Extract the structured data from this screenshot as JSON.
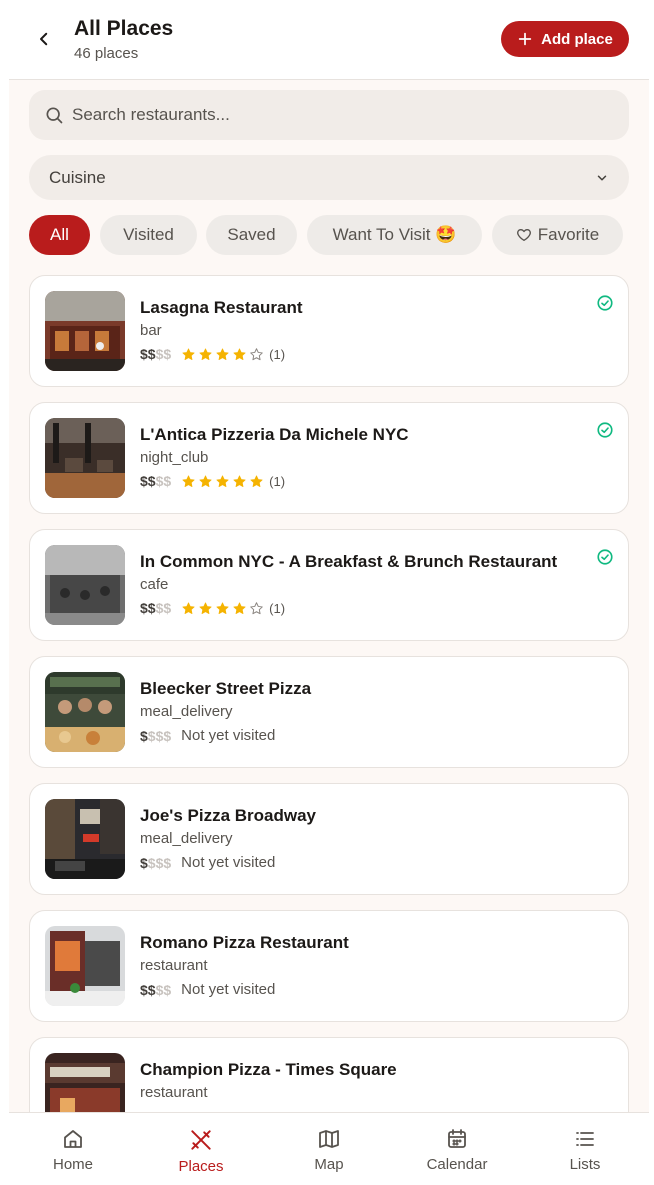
{
  "header": {
    "title": "All Places",
    "subtitle": "46 places",
    "add_label": "Add place"
  },
  "search": {
    "placeholder": "Search restaurants..."
  },
  "cuisine": {
    "label": "Cuisine"
  },
  "chips": [
    "All",
    "Visited",
    "Saved",
    "Want To Visit 🤩",
    "Favorite"
  ],
  "colors": {
    "accent": "#b91c1c",
    "star": "#f5b301",
    "check": "#10b981",
    "background": "#fdf8f5"
  },
  "places": [
    {
      "name": "Lasagna Restaurant",
      "category": "bar",
      "price_on": "$$",
      "price_off": "$$",
      "rating": 4,
      "rating_count": "(1)",
      "visited": true
    },
    {
      "name": "L'Antica Pizzeria Da Michele NYC",
      "category": "night_club",
      "price_on": "$$",
      "price_off": "$$",
      "rating": 5,
      "rating_count": "(1)",
      "visited": true
    },
    {
      "name": "In Common NYC - A Breakfast & Brunch Restaurant",
      "category": "cafe",
      "price_on": "$$",
      "price_off": "$$",
      "rating": 4,
      "rating_count": "(1)",
      "visited": true
    },
    {
      "name": "Bleecker Street Pizza",
      "category": "meal_delivery",
      "price_on": "$",
      "price_off": "$$$",
      "status": "Not yet visited",
      "visited": false
    },
    {
      "name": "Joe's Pizza Broadway",
      "category": "meal_delivery",
      "price_on": "$",
      "price_off": "$$$",
      "status": "Not yet visited",
      "visited": false
    },
    {
      "name": "Romano Pizza Restaurant",
      "category": "restaurant",
      "price_on": "$$",
      "price_off": "$$",
      "status": "Not yet visited",
      "visited": false
    },
    {
      "name": "Champion Pizza - Times Square",
      "category": "restaurant",
      "visited": false
    }
  ],
  "nav": [
    {
      "label": "Home",
      "icon": "home-icon"
    },
    {
      "label": "Places",
      "icon": "utensils-icon",
      "active": true
    },
    {
      "label": "Map",
      "icon": "map-icon"
    },
    {
      "label": "Calendar",
      "icon": "calendar-icon"
    },
    {
      "label": "Lists",
      "icon": "list-icon"
    }
  ]
}
